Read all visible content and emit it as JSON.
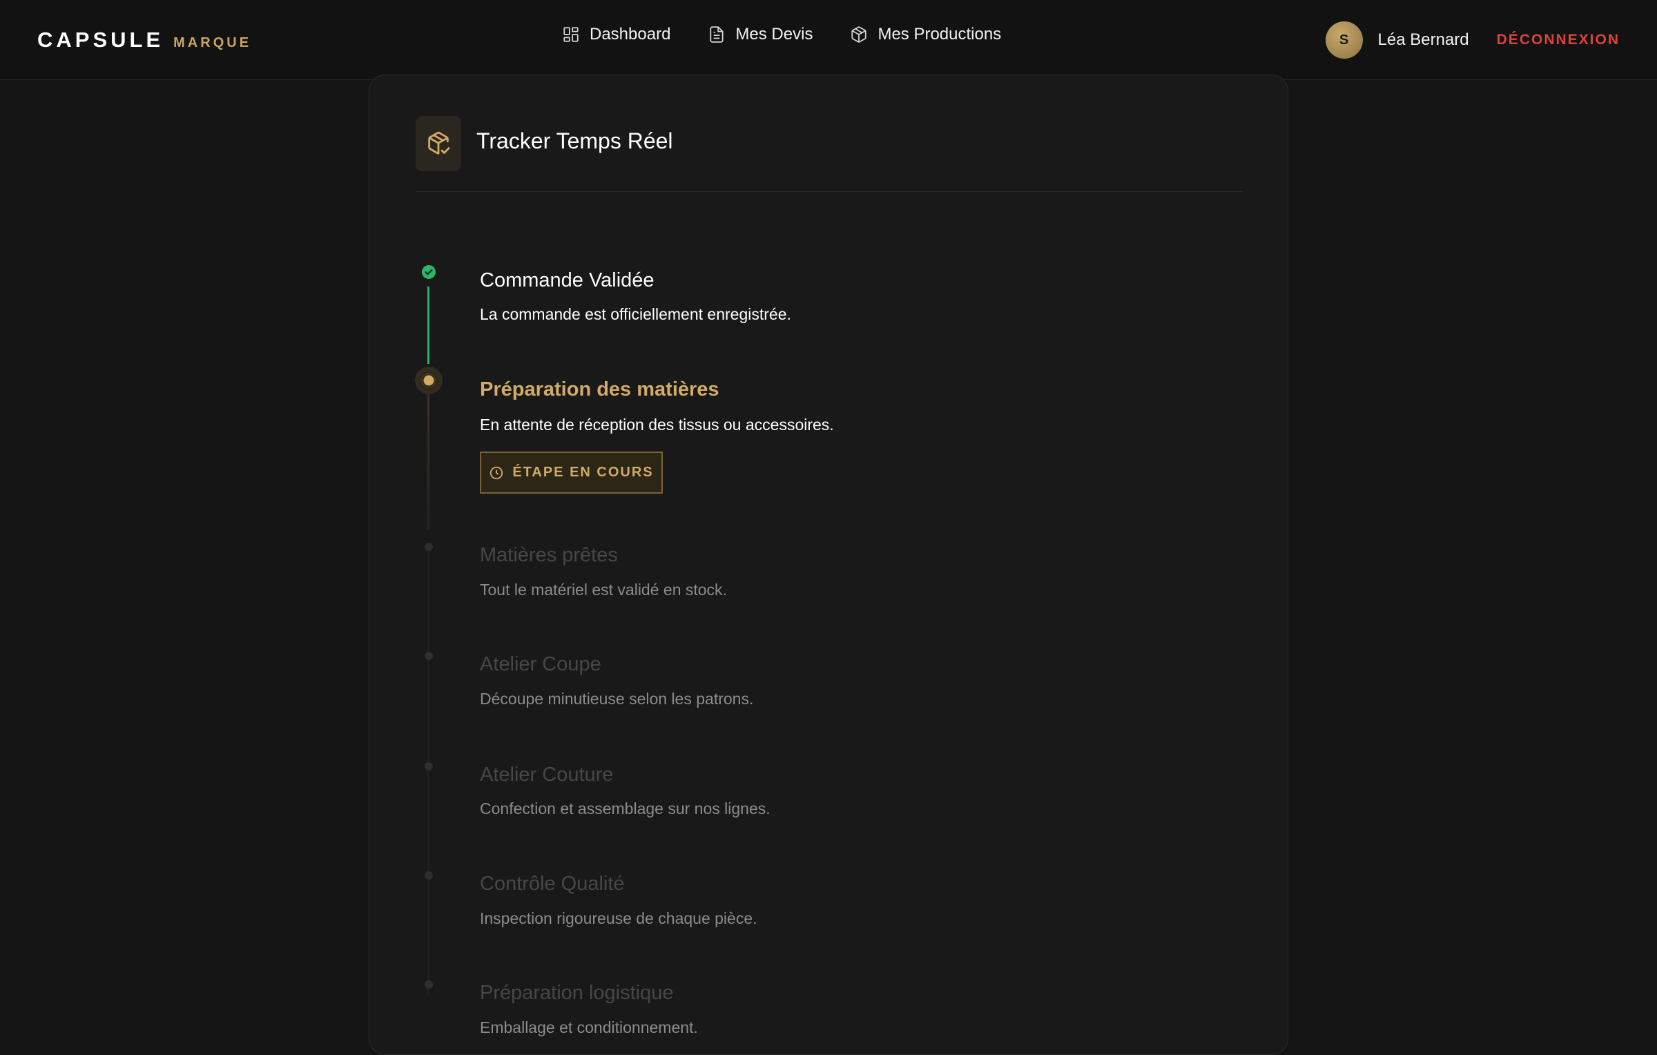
{
  "brand": {
    "name": "CAPSULE",
    "sub": "MARQUE"
  },
  "nav": [
    {
      "label": "Dashboard",
      "icon": "dashboard-icon"
    },
    {
      "label": "Mes Devis",
      "icon": "document-icon"
    },
    {
      "label": "Mes Productions",
      "icon": "package-icon"
    }
  ],
  "user": {
    "initial": "S",
    "name": "Léa Bernard",
    "logout": "DÉCONNEXION"
  },
  "tracker": {
    "title": "Tracker Temps Réel",
    "icon": "package-check-icon",
    "current_badge": "ÉTAPE EN COURS",
    "steps": [
      {
        "title": "Commande Validée",
        "desc": "La commande est officiellement enregistrée.",
        "status": "done"
      },
      {
        "title": "Préparation des matières",
        "desc": "En attente de réception des tissus ou accessoires.",
        "status": "current"
      },
      {
        "title": "Matières prêtes",
        "desc": "Tout le matériel est validé en stock.",
        "status": "pending"
      },
      {
        "title": "Atelier Coupe",
        "desc": "Découpe minutieuse selon les patrons.",
        "status": "pending"
      },
      {
        "title": "Atelier Couture",
        "desc": "Confection et assemblage sur nos lignes.",
        "status": "pending"
      },
      {
        "title": "Contrôle Qualité",
        "desc": "Inspection rigoureuse de chaque pièce.",
        "status": "pending"
      },
      {
        "title": "Préparation logistique",
        "desc": "Emballage et conditionnement.",
        "status": "pending"
      }
    ]
  },
  "colors": {
    "accent": "#d2ab65",
    "success": "#2fb36a",
    "danger": "#d9443a",
    "background": "#141414"
  }
}
